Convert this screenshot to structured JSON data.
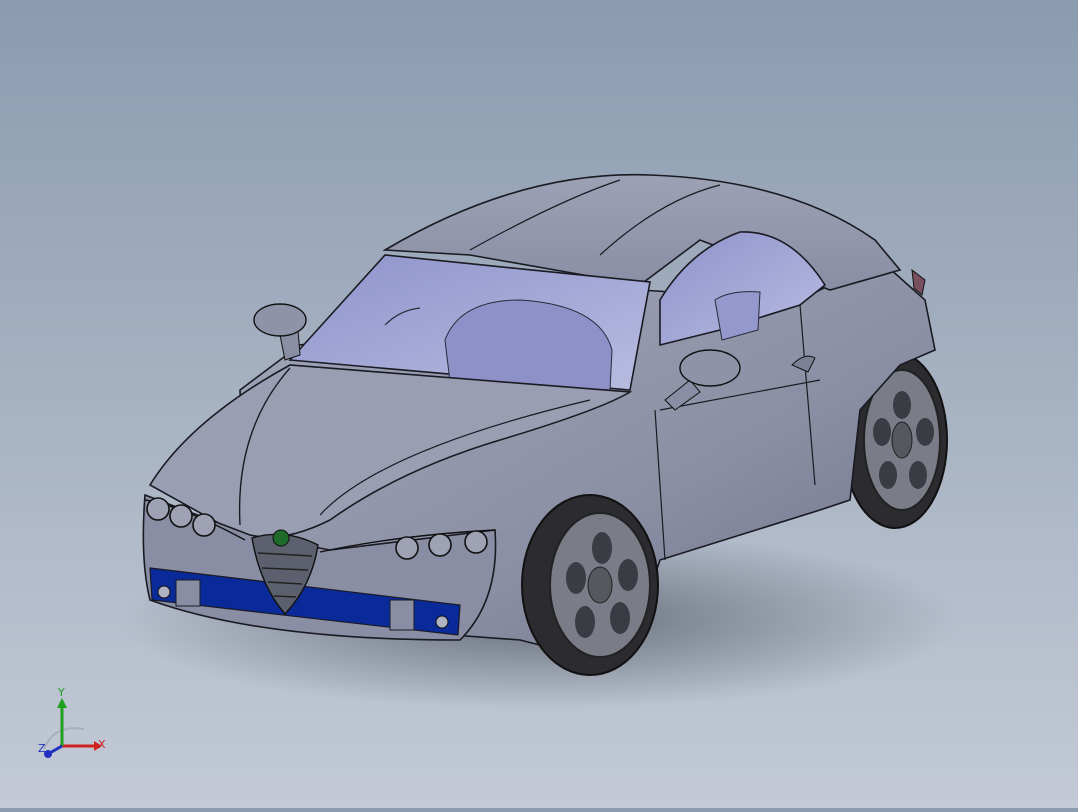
{
  "view": {
    "background_top": "#8b9bb0",
    "background_bottom": "#c3cad6"
  },
  "model": {
    "body_color": "#8e93a8",
    "glass_color": "#a5a8d8",
    "grille_bar_color": "#0a2a9a",
    "badge_color": "#1f6b2a",
    "tire_color": "#2b2b30"
  },
  "triad": {
    "x_label": "X",
    "y_label": "Y",
    "z_label": "Z",
    "x_color": "#d02020",
    "y_color": "#20a020",
    "z_color": "#2030c0"
  }
}
